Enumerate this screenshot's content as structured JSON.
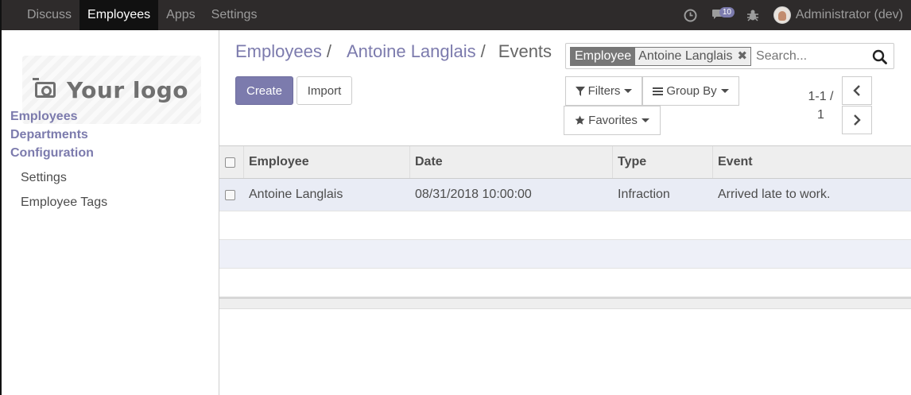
{
  "topbar": {
    "menu": [
      "Discuss",
      "Employees",
      "Apps",
      "Settings"
    ],
    "active": "Employees",
    "messages_count": "10",
    "user": "Administrator (dev)"
  },
  "sidebar": {
    "logo_text": "Your logo",
    "sections": [
      "Employees",
      "Departments",
      "Configuration"
    ],
    "config_items": [
      "Settings",
      "Employee Tags"
    ]
  },
  "breadcrumb": {
    "items": [
      "Employees",
      "Antoine Langlais"
    ],
    "current": "Events",
    "separator": "/"
  },
  "search": {
    "facet_label": "Employee",
    "facet_value": "Antoine Langlais",
    "placeholder": "Search..."
  },
  "buttons": {
    "create": "Create",
    "import": "Import",
    "filters": "Filters",
    "group_by": "Group By",
    "favorites": "Favorites"
  },
  "pager": {
    "range": "1-1 /",
    "total": "1"
  },
  "table": {
    "columns": [
      "Employee",
      "Date",
      "Type",
      "Event"
    ],
    "rows": [
      {
        "employee": "Antoine Langlais",
        "date": "08/31/2018 10:00:00",
        "type": "Infraction",
        "event": "Arrived late to work."
      }
    ]
  },
  "colors": {
    "accent": "#7c7bad",
    "navbar": "#2e2b2b"
  }
}
